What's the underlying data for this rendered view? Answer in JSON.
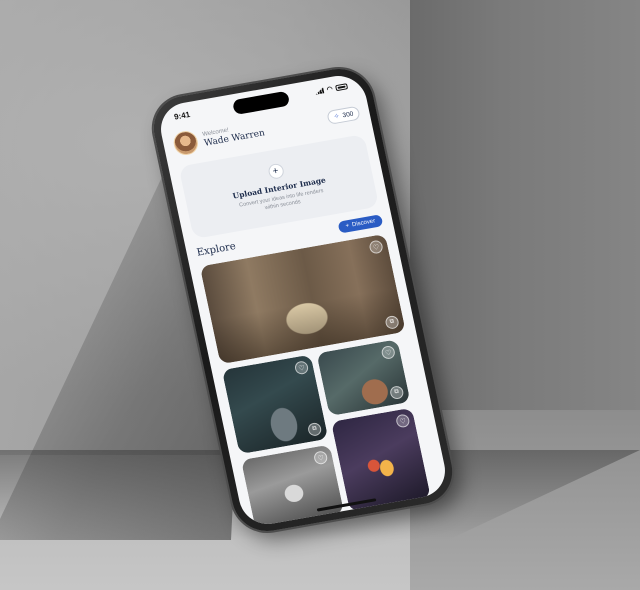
{
  "status_bar": {
    "time": "9:41"
  },
  "header": {
    "welcome": "Welcome!",
    "username": "Wade Warren",
    "credits": "300"
  },
  "upload_card": {
    "title": "Upload Interior Image",
    "subtitle": "Convert your ideas into life renders within seconds"
  },
  "explore": {
    "title": "Explore",
    "discover_label": "Discover"
  },
  "icons": {
    "plus": "+",
    "heart": "♡",
    "remix": "⧉",
    "coin": "✧"
  },
  "colors": {
    "accent": "#2a5cc4",
    "title": "#1b2a4a"
  }
}
